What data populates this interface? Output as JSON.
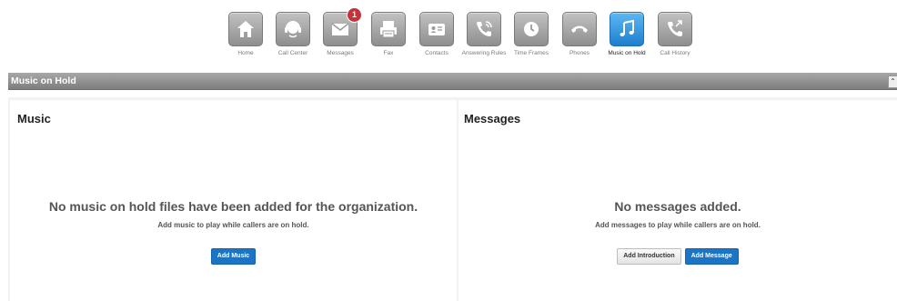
{
  "nav": {
    "items": [
      {
        "label": "Home",
        "icon": "home-icon"
      },
      {
        "label": "Call Center",
        "icon": "headset-icon"
      },
      {
        "label": "Messages",
        "icon": "envelope-icon",
        "badge": "1"
      },
      {
        "label": "Fax",
        "icon": "fax-icon"
      },
      {
        "label": "Contacts",
        "icon": "contact-card-icon"
      },
      {
        "label": "Answering Rules",
        "icon": "phone-rules-icon"
      },
      {
        "label": "Time Frames",
        "icon": "clock-icon"
      },
      {
        "label": "Phones",
        "icon": "handset-icon"
      },
      {
        "label": "Music on Hold",
        "icon": "music-note-icon",
        "active": true
      },
      {
        "label": "Call History",
        "icon": "call-history-icon"
      }
    ],
    "colors": {
      "active": "#1e7fcf",
      "inactive": "#9a9a9a",
      "badge": "#c2343a"
    }
  },
  "titlebar": {
    "title": "Music on Hold",
    "collapse_icon": "collapse-icon"
  },
  "music": {
    "heading": "Music",
    "empty_title": "No music on hold files have been added for the organization.",
    "empty_subtitle": "Add music to play while callers are on hold.",
    "add_music_label": "Add Music"
  },
  "messages": {
    "heading": "Messages",
    "empty_title": "No messages added.",
    "empty_subtitle": "Add messages to play while callers are on hold.",
    "add_introduction_label": "Add Introduction",
    "add_message_label": "Add Message"
  },
  "colors": {
    "primary_button": "#1b74c5",
    "titlebar": "#8d8d8d"
  }
}
